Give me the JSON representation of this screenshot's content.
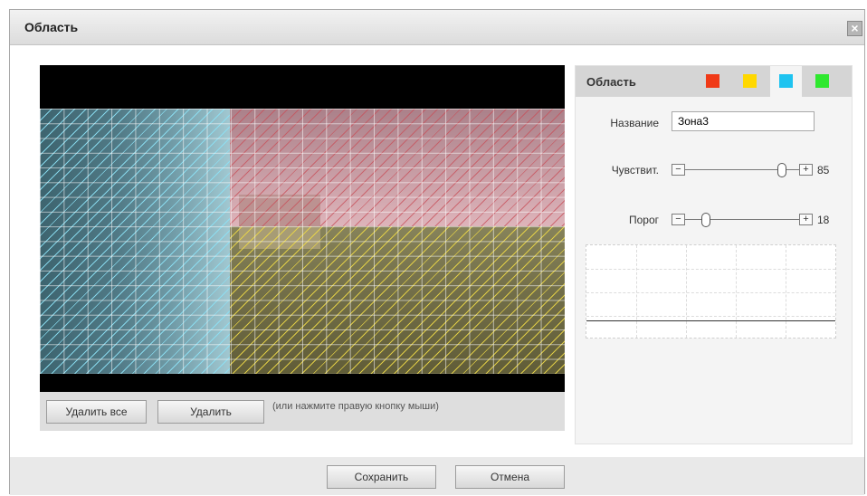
{
  "dialog": {
    "title": "Область",
    "close_label": "×"
  },
  "video": {
    "zones": [
      {
        "name": "zone-cyan",
        "color": "#1ec3e6"
      },
      {
        "name": "zone-red",
        "color": "#e53a2c"
      },
      {
        "name": "zone-yellow",
        "color": "#f5d300"
      }
    ]
  },
  "actions": {
    "delete_all": "Удалить все",
    "delete": "Удалить",
    "hint": "(или нажмите правую кнопку мыши)"
  },
  "panel": {
    "title": "Область",
    "swatches": [
      {
        "name": "red",
        "color": "#f03a17"
      },
      {
        "name": "yellow",
        "color": "#ffd800"
      },
      {
        "name": "cyan",
        "color": "#1ec3f0",
        "selected": true
      },
      {
        "name": "green",
        "color": "#2ee82e"
      }
    ],
    "name_label": "Название",
    "name_value": "Зона3",
    "sensitivity_label": "Чувствит.",
    "sensitivity_value": "85",
    "sensitivity_fraction": 0.85,
    "threshold_label": "Порог",
    "threshold_value": "18",
    "threshold_fraction": 0.18,
    "minus_label": "−",
    "plus_label": "+"
  },
  "footer": {
    "save": "Сохранить",
    "cancel": "Отмена"
  }
}
